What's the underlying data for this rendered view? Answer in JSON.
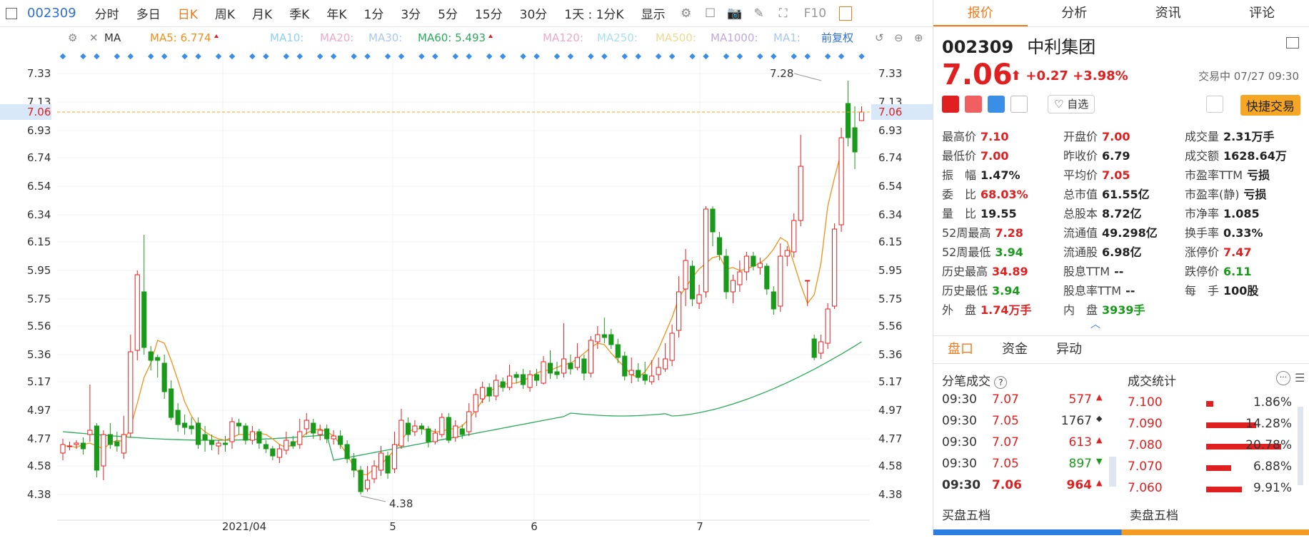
{
  "toolbar": {
    "code": "002309",
    "tabs": [
      "分时",
      "多日",
      "日K",
      "周K",
      "月K",
      "季K",
      "年K",
      "1分",
      "3分",
      "5分",
      "15分",
      "30分"
    ],
    "active_tab": "日K",
    "interval_select": "1天 : 1分K",
    "display_select": "显示",
    "f10_label": "F10"
  },
  "indicator_bar": {
    "ma_label": "MA",
    "ma5": "MA5: 6.774",
    "ma10": "MA10:",
    "ma20": "MA20:",
    "ma30": "MA30:",
    "ma60": "MA60: 5.493",
    "ma120": "MA120:",
    "ma250": "MA250:",
    "ma500": "MA500:",
    "ma1000": "MA1000:",
    "ma1": "MA1:",
    "adjust": "前复权"
  },
  "colors": {
    "up": "#e02020",
    "down": "#1a9a1a",
    "ma5": "#f0901a",
    "ma60": "#2aaa5a",
    "accent": "#f07a1a",
    "link": "#2f6fd6"
  },
  "chart_data": {
    "type": "candlestick",
    "ylim": [
      4.3,
      7.4
    ],
    "y_ticks": [
      "7.33",
      "7.13",
      "6.93",
      "6.74",
      "6.54",
      "6.34",
      "6.15",
      "5.95",
      "5.75",
      "5.56",
      "5.36",
      "5.17",
      "4.97",
      "4.77",
      "4.58",
      "4.38"
    ],
    "x_labels": [
      "2021/04",
      "5",
      "6",
      "7"
    ],
    "current_price": "7.06",
    "high_label": "7.28",
    "low_label": "4.38",
    "candles": [
      [
        4.67,
        4.73,
        4.62,
        4.77
      ],
      [
        4.72,
        4.72,
        4.69,
        4.75
      ],
      [
        4.73,
        4.74,
        4.7,
        4.76
      ],
      [
        4.74,
        4.7,
        4.66,
        4.78
      ],
      [
        4.8,
        4.83,
        4.75,
        5.15
      ],
      [
        4.86,
        4.55,
        4.5,
        4.88
      ],
      [
        4.58,
        4.8,
        4.48,
        4.83
      ],
      [
        4.8,
        4.73,
        4.7,
        4.88
      ],
      [
        4.75,
        4.72,
        4.68,
        4.82
      ],
      [
        4.67,
        4.8,
        4.63,
        4.93
      ],
      [
        4.81,
        5.38,
        4.78,
        5.5
      ],
      [
        5.39,
        5.92,
        5.32,
        5.95
      ],
      [
        5.8,
        5.41,
        5.36,
        6.2
      ],
      [
        5.38,
        5.32,
        5.25,
        5.42
      ],
      [
        5.34,
        5.32,
        5.2,
        5.36
      ],
      [
        5.3,
        5.1,
        5.05,
        5.36
      ],
      [
        5.12,
        4.92,
        4.9,
        5.18
      ],
      [
        4.97,
        4.87,
        4.82,
        5.02
      ],
      [
        4.88,
        4.85,
        4.8,
        4.94
      ],
      [
        4.86,
        4.84,
        4.8,
        4.92
      ],
      [
        4.88,
        4.73,
        4.7,
        4.92
      ],
      [
        4.8,
        4.76,
        4.68,
        4.86
      ],
      [
        4.76,
        4.73,
        4.69,
        4.8
      ],
      [
        4.72,
        4.74,
        4.66,
        4.76
      ],
      [
        4.74,
        4.73,
        4.68,
        4.79
      ],
      [
        4.75,
        4.89,
        4.7,
        4.92
      ],
      [
        4.88,
        4.86,
        4.8,
        4.91
      ],
      [
        4.86,
        4.76,
        4.73,
        4.88
      ],
      [
        4.76,
        4.82,
        4.73,
        4.86
      ],
      [
        4.82,
        4.74,
        4.7,
        4.84
      ],
      [
        4.73,
        4.7,
        4.67,
        4.76
      ],
      [
        4.7,
        4.65,
        4.62,
        4.72
      ],
      [
        4.64,
        4.7,
        4.6,
        4.73
      ],
      [
        4.69,
        4.76,
        4.66,
        4.82
      ],
      [
        4.75,
        4.72,
        4.7,
        4.79
      ],
      [
        4.73,
        4.82,
        4.7,
        4.91
      ],
      [
        4.84,
        4.9,
        4.8,
        4.95
      ],
      [
        4.88,
        4.81,
        4.77,
        4.91
      ],
      [
        4.8,
        4.83,
        4.76,
        4.87
      ],
      [
        4.84,
        4.77,
        4.74,
        4.87
      ],
      [
        4.77,
        4.79,
        4.73,
        4.83
      ],
      [
        4.79,
        4.73,
        4.7,
        4.83
      ],
      [
        4.73,
        4.63,
        4.6,
        4.76
      ],
      [
        4.63,
        4.55,
        4.5,
        4.67
      ],
      [
        4.55,
        4.4,
        4.38,
        4.58
      ],
      [
        4.42,
        4.48,
        4.4,
        4.58
      ],
      [
        4.49,
        4.58,
        4.46,
        4.62
      ],
      [
        4.55,
        4.67,
        4.51,
        4.72
      ],
      [
        4.65,
        4.53,
        4.49,
        4.68
      ],
      [
        4.56,
        4.73,
        4.53,
        4.82
      ],
      [
        4.72,
        4.9,
        4.7,
        4.98
      ],
      [
        4.88,
        4.8,
        4.75,
        4.92
      ],
      [
        4.82,
        4.86,
        4.79,
        4.9
      ],
      [
        4.86,
        4.84,
        4.8,
        4.88
      ],
      [
        4.84,
        4.75,
        4.71,
        4.86
      ],
      [
        4.75,
        4.81,
        4.73,
        4.84
      ],
      [
        4.8,
        4.92,
        4.78,
        4.95
      ],
      [
        4.92,
        4.76,
        4.74,
        4.95
      ],
      [
        4.78,
        4.86,
        4.75,
        4.9
      ],
      [
        4.84,
        4.8,
        4.77,
        4.87
      ],
      [
        4.82,
        4.96,
        4.79,
        5.02
      ],
      [
        4.96,
        5.08,
        4.92,
        5.12
      ],
      [
        5.05,
        5.13,
        5.02,
        5.17
      ],
      [
        5.13,
        5.07,
        5.03,
        5.16
      ],
      [
        5.07,
        5.18,
        5.04,
        5.22
      ],
      [
        5.17,
        5.13,
        5.1,
        5.2
      ],
      [
        5.13,
        5.21,
        5.11,
        5.29
      ],
      [
        5.22,
        5.2,
        5.16,
        5.24
      ],
      [
        5.22,
        5.15,
        5.12,
        5.26
      ],
      [
        5.13,
        5.22,
        5.1,
        5.25
      ],
      [
        5.22,
        5.18,
        5.14,
        5.26
      ],
      [
        5.16,
        5.31,
        5.15,
        5.35
      ],
      [
        5.3,
        5.23,
        5.19,
        5.39
      ],
      [
        5.24,
        5.22,
        5.19,
        5.31
      ],
      [
        5.23,
        5.33,
        5.2,
        5.58
      ],
      [
        5.3,
        5.26,
        5.22,
        5.36
      ],
      [
        5.27,
        5.34,
        5.25,
        5.44
      ],
      [
        5.33,
        5.23,
        5.18,
        5.36
      ],
      [
        5.23,
        5.46,
        5.2,
        5.49
      ],
      [
        5.45,
        5.5,
        5.4,
        5.56
      ],
      [
        5.5,
        5.48,
        5.44,
        5.62
      ],
      [
        5.5,
        5.43,
        5.4,
        5.54
      ],
      [
        5.43,
        5.34,
        5.3,
        5.47
      ],
      [
        5.35,
        5.21,
        5.18,
        5.38
      ],
      [
        5.22,
        5.25,
        5.16,
        5.34
      ],
      [
        5.25,
        5.2,
        5.17,
        5.3
      ],
      [
        5.22,
        5.18,
        5.15,
        5.31
      ],
      [
        5.17,
        5.21,
        5.15,
        5.32
      ],
      [
        5.22,
        5.27,
        5.18,
        5.34
      ],
      [
        5.26,
        5.33,
        5.24,
        5.44
      ],
      [
        5.32,
        5.51,
        5.28,
        5.57
      ],
      [
        5.53,
        5.8,
        5.48,
        5.91
      ],
      [
        5.82,
        6.02,
        5.7,
        6.1
      ],
      [
        5.98,
        5.75,
        5.7,
        6.02
      ],
      [
        5.72,
        5.78,
        5.68,
        5.85
      ],
      [
        5.8,
        6.38,
        5.76,
        6.4
      ],
      [
        6.38,
        6.22,
        6.12,
        6.4
      ],
      [
        6.18,
        6.06,
        6.02,
        6.22
      ],
      [
        6.05,
        5.8,
        5.75,
        6.1
      ],
      [
        5.8,
        5.88,
        5.72,
        5.92
      ],
      [
        5.85,
        5.94,
        5.8,
        6.02
      ],
      [
        5.94,
        6.05,
        5.88,
        6.08
      ],
      [
        6.05,
        5.98,
        5.95,
        6.08
      ],
      [
        5.97,
        6.0,
        5.92,
        6.04
      ],
      [
        5.98,
        5.82,
        5.78,
        6.0
      ],
      [
        5.8,
        5.68,
        5.64,
        5.84
      ],
      [
        5.7,
        6.05,
        5.66,
        6.14
      ],
      [
        6.05,
        6.09,
        5.98,
        6.12
      ],
      [
        6.08,
        6.3,
        6.04,
        6.35
      ],
      [
        6.3,
        6.68,
        6.26,
        6.9
      ],
      [
        5.88,
        5.88,
        5.7,
        5.88
      ],
      [
        5.47,
        5.34,
        5.32,
        5.5
      ],
      [
        5.37,
        5.45,
        5.33,
        5.5
      ],
      [
        5.44,
        5.68,
        5.4,
        5.72
      ],
      [
        5.7,
        6.24,
        5.68,
        6.28
      ],
      [
        6.27,
        6.88,
        6.22,
        6.95
      ],
      [
        7.12,
        6.88,
        6.82,
        7.28
      ],
      [
        6.95,
        6.78,
        6.66,
        7.1
      ],
      [
        7.0,
        7.06,
        7.0,
        7.1
      ]
    ],
    "ma5": [
      4.72,
      4.72,
      4.71,
      4.73,
      4.74,
      4.72,
      4.7,
      4.74,
      4.76,
      4.75,
      4.85,
      5.02,
      5.2,
      5.3,
      5.46,
      5.44,
      5.32,
      5.18,
      5.03,
      4.93,
      4.86,
      4.82,
      4.79,
      4.77,
      4.76,
      4.78,
      4.8,
      4.8,
      4.8,
      4.81,
      4.8,
      4.77,
      4.73,
      4.71,
      4.73,
      4.77,
      4.81,
      4.83,
      4.84,
      4.82,
      4.79,
      4.73,
      4.66,
      4.57,
      4.52,
      4.52,
      4.56,
      4.59,
      4.64,
      4.69,
      4.76,
      4.82,
      4.84,
      4.84,
      4.83,
      4.82,
      4.82,
      4.84,
      4.84,
      4.86,
      4.91,
      4.97,
      5.04,
      5.1,
      5.13,
      5.15,
      5.16,
      5.16,
      5.18,
      5.2,
      5.23,
      5.25,
      5.25,
      5.27,
      5.29,
      5.3,
      5.33,
      5.37,
      5.41,
      5.44,
      5.43,
      5.37,
      5.32,
      5.27,
      5.22,
      5.2,
      5.24,
      5.31,
      5.4,
      5.51,
      5.62,
      5.76,
      5.83,
      5.9,
      5.96,
      6.0,
      6.04,
      6.05,
      5.96,
      5.97,
      5.95,
      5.96,
      5.98,
      6.0,
      6.04,
      6.1,
      6.18,
      6.15,
      6.0,
      5.85,
      5.72,
      5.78,
      6.0,
      6.4,
      6.6,
      6.78
    ]
  },
  "quote": {
    "code": "002309",
    "name": "中利集团",
    "price": "7.06",
    "change": "+0.27",
    "change_pct": "+3.98%",
    "status_time": "交易中 07/27 09:30",
    "watch_label": "自选",
    "fast_trade": "快捷交易",
    "stats": [
      [
        {
          "l": "最高价",
          "v": "7.10",
          "c": "red"
        },
        {
          "l": "开盘价",
          "v": "7.00",
          "c": "red"
        },
        {
          "l": "成交量",
          "v": "2.31万手",
          "c": "dark"
        }
      ],
      [
        {
          "l": "最低价",
          "v": "7.00",
          "c": "red"
        },
        {
          "l": "昨收价",
          "v": "6.79",
          "c": "dark"
        },
        {
          "l": "成交额",
          "v": "1628.64万",
          "c": "dark"
        }
      ],
      [
        {
          "l": "振　幅",
          "v": "1.47%",
          "c": "dark"
        },
        {
          "l": "平均价",
          "v": "7.05",
          "c": "red"
        },
        {
          "l": "市盈率TTM",
          "v": "亏损",
          "c": "dark"
        }
      ],
      [
        {
          "l": "委　比",
          "v": "68.03%",
          "c": "red"
        },
        {
          "l": "总市值",
          "v": "61.55亿",
          "c": "dark"
        },
        {
          "l": "市盈率(静)",
          "v": "亏损",
          "c": "dark"
        }
      ],
      [
        {
          "l": "量　比",
          "v": "19.55",
          "c": "dark"
        },
        {
          "l": "总股本",
          "v": "8.72亿",
          "c": "dark"
        },
        {
          "l": "市净率",
          "v": "1.085",
          "c": "dark"
        }
      ],
      [
        {
          "l": "52周最高",
          "v": "7.28",
          "c": "red"
        },
        {
          "l": "流通值",
          "v": "49.298亿",
          "c": "dark"
        },
        {
          "l": "换手率",
          "v": "0.33%",
          "c": "dark"
        }
      ],
      [
        {
          "l": "52周最低",
          "v": "3.94",
          "c": "green"
        },
        {
          "l": "流通股",
          "v": "6.98亿",
          "c": "dark"
        },
        {
          "l": "涨停价",
          "v": "7.47",
          "c": "red"
        }
      ],
      [
        {
          "l": "历史最高",
          "v": "34.89",
          "c": "red"
        },
        {
          "l": "股息TTM",
          "v": "--",
          "c": "dark"
        },
        {
          "l": "跌停价",
          "v": "6.11",
          "c": "green"
        }
      ],
      [
        {
          "l": "历史最低",
          "v": "3.94",
          "c": "green"
        },
        {
          "l": "股息率TTM",
          "v": "--",
          "c": "dark"
        },
        {
          "l": "每　手",
          "v": "100股",
          "c": "dark"
        }
      ],
      [
        {
          "l": "外　盘",
          "v": "1.74万手",
          "c": "red"
        },
        {
          "l": "内　盘",
          "v": "3939手",
          "c": "green"
        },
        {
          "l": "",
          "v": "",
          "c": "dark"
        }
      ]
    ]
  },
  "subtabs": [
    "盘口",
    "资金",
    "异动"
  ],
  "ticks_title": "分笔成交",
  "stat_title": "成交统计",
  "ticks": [
    {
      "t": "09:30",
      "p": "7.07",
      "v": "577",
      "dir": "up"
    },
    {
      "t": "09:30",
      "p": "7.05",
      "v": "1767",
      "dir": "flat"
    },
    {
      "t": "09:30",
      "p": "7.07",
      "v": "613",
      "dir": "up"
    },
    {
      "t": "09:30",
      "p": "7.05",
      "v": "897",
      "dir": "down"
    },
    {
      "t": "09:30",
      "p": "7.06",
      "v": "964",
      "dir": "up"
    }
  ],
  "trade_stats": [
    {
      "p": "7.100",
      "pct": "1.86%",
      "share": 0.02
    },
    {
      "p": "7.090",
      "pct": "14.28%",
      "share": 0.14
    },
    {
      "p": "7.080",
      "pct": "20.78%",
      "share": 0.21
    },
    {
      "p": "7.070",
      "pct": "6.88%",
      "share": 0.07
    },
    {
      "p": "7.060",
      "pct": "9.91%",
      "share": 0.1
    }
  ],
  "bottom": {
    "buy5": "买盘五档",
    "sell5": "卖盘五档"
  }
}
